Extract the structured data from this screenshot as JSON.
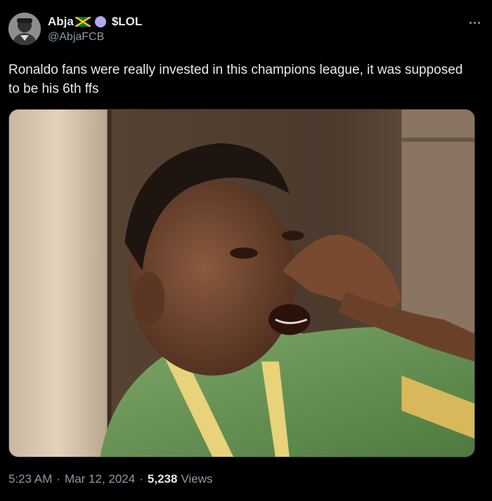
{
  "author": {
    "display_name": "Abja",
    "suffix": "$LOL",
    "handle": "@AbjaFCB",
    "flag_icon": "jamaica-flag-icon",
    "badge_color": "#b9a6f5"
  },
  "tweet": {
    "text": "Ronaldo fans were really invested in this champions league, it was supposed to be his 6th ffs"
  },
  "meta": {
    "time": "5:23 AM",
    "date": "Mar 12, 2024",
    "views_count": "5,238",
    "views_label": "Views",
    "separator": "·"
  },
  "colors": {
    "background": "#000000",
    "text": "#e7e9ea",
    "secondary_text": "#8b98a5"
  }
}
